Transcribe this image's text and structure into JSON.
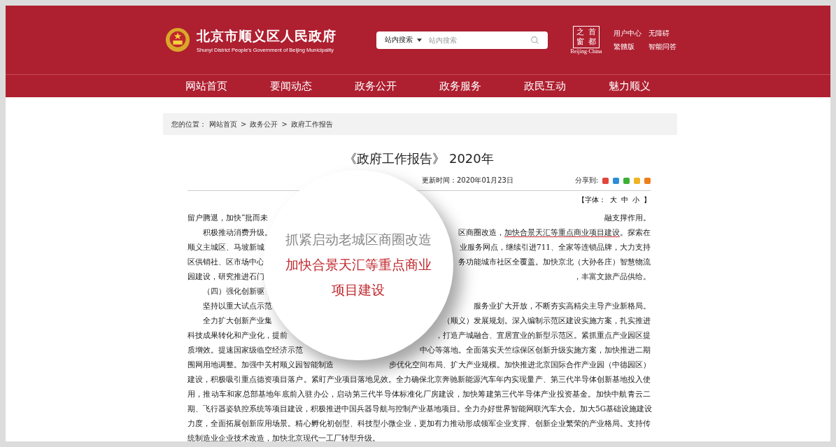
{
  "header": {
    "site_title": "北京市顺义区人民政府",
    "site_subtitle": "Shunyi District People's Government of Beijing Municipality",
    "search": {
      "scope": "站内搜索",
      "placeholder": "站内搜索"
    },
    "badge": {
      "chars": [
        "之",
        "首",
        "窗",
        "都"
      ],
      "caption": "Beijing·China"
    },
    "links": [
      "用户中心",
      "无障碍",
      "繁體版",
      "智能问答"
    ]
  },
  "nav": [
    "网站首页",
    "要闻动态",
    "政务公开",
    "政务服务",
    "政民互动",
    "魅力顺义"
  ],
  "breadcrumb": {
    "label": "您的位置：",
    "items": [
      "网站首页",
      "政务公开",
      "政府工作报告"
    ],
    "separator": ">"
  },
  "article": {
    "title": "《政府工作报告》 2020年",
    "updated": "更新时间：2020年01月23日",
    "share_label": "分享到:",
    "share": [
      {
        "color": "#e2453c"
      },
      {
        "color": "#2b8fd6"
      },
      {
        "color": "#3cb035"
      },
      {
        "color": "#f0b323"
      },
      {
        "color": "#f07d1c"
      }
    ],
    "font_size": {
      "open": "【字体：",
      "options": [
        "大",
        "中",
        "小"
      ],
      "close": "】"
    },
    "lines": [
      {
        "indent": false,
        "left": "留户腾退，加快“批而未",
        "right": [
          {
            "text": "融支撑作用。",
            "underline": false
          }
        ]
      },
      {
        "indent": true,
        "left": "积极推动消费升级。",
        "right": [
          {
            "text": "区商圈改造，",
            "underline": false
          },
          {
            "text": "加快合景天汇等重点商业项目建设",
            "underline": true
          },
          {
            "text": "。探索在",
            "underline": false
          }
        ]
      },
      {
        "indent": false,
        "left": "顺义主城区、马坡新城",
        "right": [
          {
            "text": "业服务网点，继续引进711、全家等连锁品牌，大力支持",
            "underline": false
          }
        ]
      },
      {
        "indent": false,
        "left": "区供销社、区市场中心",
        "right": [
          {
            "text": "务功能城市社区全覆盖。加快京北（大孙各庄）智慧物流",
            "underline": false
          }
        ]
      },
      {
        "indent": false,
        "left": "园建设，研究推进石门",
        "right": [
          {
            "text": "，丰富文旅产品供给。",
            "underline": false
          }
        ]
      },
      {
        "indent": true,
        "left": "（四）强化创新驱"
      },
      {
        "indent": true,
        "left": "坚持以重大试点示范",
        "right": [
          {
            "text": "服务业扩大开放，不断夯实高精尖主导产业新格局。",
            "underline": false
          }
        ]
      },
      {
        "indent": true,
        "left": "全力扩大创新产业集",
        "right": [
          {
            "text": "（顺义）发展规划。深入编制示范区建设实施方案，扎实推进",
            "underline": false
          }
        ]
      },
      {
        "indent": false,
        "left": "科技成果转化和产业化，提前",
        "right": [
          {
            "text": "，打造产城融合、宜居宜业的新型示范区。紧抓重点产业园区提",
            "underline": false
          }
        ]
      },
      {
        "indent": false,
        "left": "质增效。提速国家级临空经济示范",
        "right": [
          {
            "text": "中心等落地。全面落实天竺综保区创新升级实施方案，加快推进二期",
            "underline": false
          }
        ]
      },
      {
        "indent": false,
        "left": "围网用地调整。加强中关村顺义园智能制造",
        "right": [
          {
            "text": "步优化空间布局、扩大产业规模。加快推进北京国际合作产业园（中德园区）",
            "underline": false
          }
        ]
      },
      {
        "indent": false,
        "left": "建设，积极吸引重点德资项目落户。紧盯产业项目落地见效。全力确保北京奔驰新能源汽车年内实现量产、第三代半导体创新基地投入使"
      },
      {
        "indent": false,
        "left": "用，推动车和家总部基地年底前入驻办公，启动第三代半导体标准化厂房建设，加快筹建第三代半导体产业投资基金。加快中航青云二"
      },
      {
        "indent": false,
        "left": "期、飞行器姿轨控系统等项目建设，积极推进中国兵器导航与控制产业基地项目。全力办好世界智能网联汽车大会。加大5G基础设施建设"
      },
      {
        "indent": false,
        "left": "力度，全面拓展创新应用场景。精心孵化初创型、科技型小微企业，更加有力推动形成领军企业支撑、创新企业繁荣的产业格局。支持传"
      },
      {
        "indent": false,
        "left": "统制造业企业技术改造，加快北京现代一工厂转型升级。"
      }
    ]
  },
  "magnifier": [
    {
      "text": "抓紧启动老城区商圈改造",
      "kind": "plain"
    },
    {
      "text": "加快合景天汇等重点商业",
      "kind": "highlight"
    },
    {
      "text": "项目建设",
      "kind": "highlight"
    }
  ]
}
